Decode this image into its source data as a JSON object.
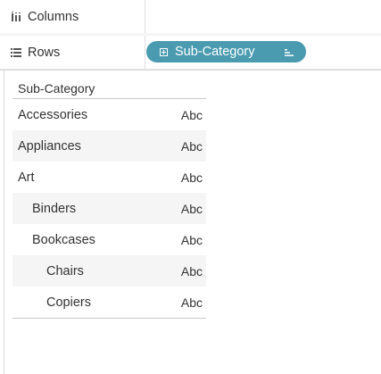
{
  "columns_shelf": {
    "label": "Columns",
    "icon": "columns-icon"
  },
  "rows_shelf": {
    "label": "Rows",
    "icon": "rows-icon",
    "pill": {
      "label": "Sub-Category",
      "expand_icon": "expand-icon",
      "sort_icon": "sort-icon",
      "color": "#4a9bb0"
    }
  },
  "table": {
    "header": "Sub-Category",
    "rows": [
      {
        "label": "Accessories",
        "value": "Abc",
        "indent": 0
      },
      {
        "label": "Appliances",
        "value": "Abc",
        "indent": 0
      },
      {
        "label": "Art",
        "value": "Abc",
        "indent": 0
      },
      {
        "label": "Binders",
        "value": "Abc",
        "indent": 1
      },
      {
        "label": "Bookcases",
        "value": "Abc",
        "indent": 1
      },
      {
        "label": "Chairs",
        "value": "Abc",
        "indent": 2
      },
      {
        "label": "Copiers",
        "value": "Abc",
        "indent": 2
      }
    ]
  }
}
